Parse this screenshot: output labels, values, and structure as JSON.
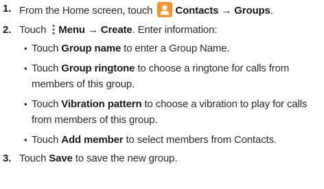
{
  "steps": [
    {
      "number": "1.",
      "parts": {
        "a": "From the Home screen, touch ",
        "icon": "contacts-app-icon",
        "b": "Contacts",
        "arrow": " → ",
        "c": "Groups",
        "d": "."
      }
    },
    {
      "number": "2.",
      "parts": {
        "a": "Touch ",
        "icon": "menu-dots-icon",
        "b": "Menu",
        "arrow": " → ",
        "c": "Create",
        "d": ". Enter information:"
      },
      "bullets": [
        {
          "term": "Group name",
          "text": " to enter a Group Name.",
          "lead": "Touch "
        },
        {
          "term": "Group ringtone",
          "text": " to choose a ringtone for calls from members of this group.",
          "lead": "Touch "
        },
        {
          "term": "Vibration pattern",
          "text": " to choose a vibration to play for calls from members of this group.",
          "lead": "Touch "
        },
        {
          "term": "Add member",
          "text": " to select members from Contacts.",
          "lead": "Touch "
        }
      ]
    },
    {
      "number": "3.",
      "parts": {
        "a": "Touch ",
        "b": "Save",
        "d": " to save the new group."
      }
    }
  ],
  "bullet_glyph": "•",
  "colors": {
    "text": "#2b2b2b",
    "icon_orange": "#f28c28",
    "icon_orange_dark": "#d9731a",
    "menu_dots": "#6b6b6b"
  }
}
